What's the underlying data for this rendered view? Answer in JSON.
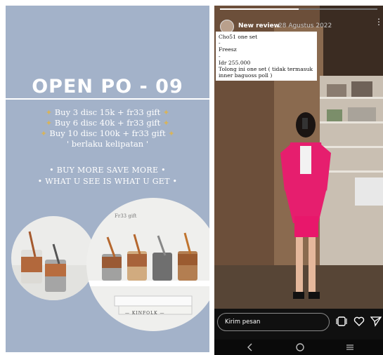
{
  "left_panel": {
    "title": "OPEN PO - 09",
    "offers": [
      "Buy 3 disc 15k + fr33 gift",
      "Buy 6 disc 40k + fr33 gift",
      "Buy 10 disc 100k + fr33 gift",
      "' berlaku kelipatan '"
    ],
    "taglines": [
      "• BUY MORE SAVE MORE •",
      "• WHAT U SEE IS WHAT U GET •"
    ],
    "gift_label": "Fr33 gift",
    "book_label": "— KINFOLK —"
  },
  "right_panel": {
    "story_user": "New review",
    "story_date": "28 Agustus 2022",
    "progress": 0.5,
    "caption_lines": [
      "Cho51 one set",
      "-",
      "Freesz",
      "-",
      "Idr 255.000",
      "Tolong ini one set ( tidak termasuk",
      "inner baguoss poll )"
    ],
    "reply_placeholder": "Kirim pesan",
    "icons": [
      "sticker-icon",
      "heart-icon",
      "send-icon",
      "back-icon",
      "home-icon",
      "recents-icon",
      "more-icon"
    ]
  }
}
